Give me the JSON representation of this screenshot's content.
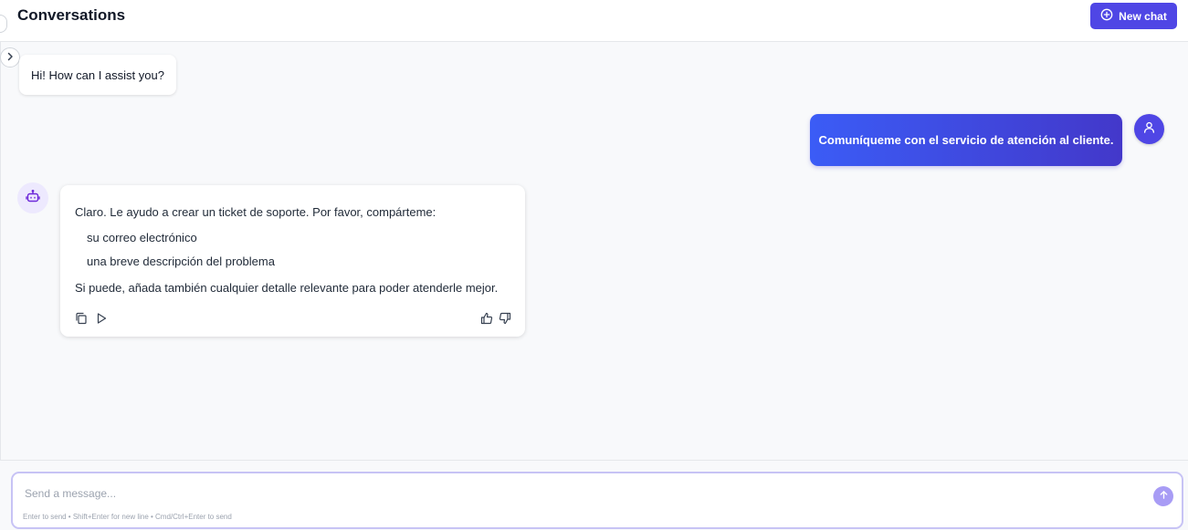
{
  "header": {
    "title": "Conversations",
    "new_chat_label": "New chat",
    "new_chat_icon": "plus-circle-icon"
  },
  "colors": {
    "accent": "#4f46e5",
    "user_bubble_start": "#3b5cf6",
    "user_bubble_end": "#4338ca",
    "bot_avatar_bg": "#ede9fe",
    "send_button": "#a89cf5"
  },
  "messages": {
    "greeting": "Hi! How can I assist you?",
    "user": "Comuníqueme con el servicio de atención al cliente.",
    "bot": {
      "intro": "Claro. Le ayudo a crear un ticket de soporte. Por favor, compárteme:",
      "items": [
        "su correo electrónico",
        "una breve descripción del problema"
      ],
      "outro": "Si puede, añada también cualquier detalle relevante para poder atenderle mejor.",
      "actions": [
        "copy-icon",
        "play-icon",
        "thumbs-up-icon",
        "thumbs-down-icon"
      ]
    }
  },
  "composer": {
    "placeholder": "Send a message...",
    "value": "",
    "hint": "Enter to send • Shift+Enter for new line • Cmd/Ctrl+Enter to send",
    "send_icon": "arrow-up-icon"
  },
  "sidebar": {
    "toggle_icon": "chevron-right-icon"
  }
}
